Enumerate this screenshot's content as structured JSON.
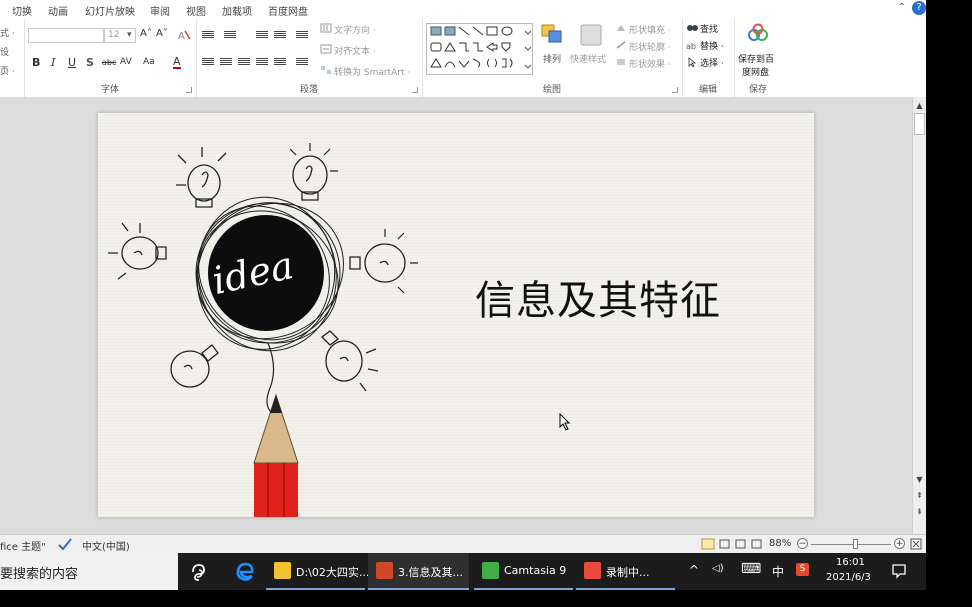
{
  "menu": {
    "tabs": [
      "切换",
      "动画",
      "幻灯片放映",
      "审阅",
      "视图",
      "加载项",
      "百度网盘"
    ],
    "minimize_glyph": "⌃",
    "help_glyph": "?"
  },
  "ribbon": {
    "left_partial": [
      "式 ·",
      "设",
      "页 ·"
    ],
    "font": {
      "label": "字体",
      "size_value": "12",
      "size_arrow": "▾",
      "grow": "A˄",
      "shrink": "A˅",
      "bold": "B",
      "italic": "I",
      "underline": "U",
      "shadow": "S",
      "strike": "abc",
      "spacing": "AV",
      "case": "Aa",
      "color": "A"
    },
    "paragraph": {
      "label": "段落",
      "text_direction": "文字方向 ·",
      "align_text": "对齐文本 ·",
      "smartart": "转换为 SmartArt ·"
    },
    "drawing": {
      "label": "绘图",
      "arrange": "排列",
      "quick_styles": "快速样式",
      "shape_fill": "形状填充 ·",
      "shape_outline": "形状轮廓 ·",
      "shape_effects": "形状效果 ·"
    },
    "editing": {
      "label": "编辑",
      "find": "查找",
      "replace": "替换 ·",
      "select": "选择 ·"
    },
    "save": {
      "label": "保存",
      "line1": "保存到百",
      "line2": "度网盘"
    }
  },
  "slide": {
    "title": "信息及其特征",
    "idea_text": "idea"
  },
  "status": {
    "theme": "fice 主题\"",
    "language": "中文(中国)",
    "zoom": "88%",
    "zoom_minus": "−",
    "zoom_plus": "+",
    "zoom_level": 0.55
  },
  "taskbar": {
    "search_text": "要搜索的内容",
    "apps": [
      {
        "label": "D:\\02大四实...",
        "color": "#f2c230"
      },
      {
        "label": "3.信息及其...",
        "color": "#d24726"
      },
      {
        "label": "Camtasia 9",
        "color": "#3fae49"
      },
      {
        "label": "录制中...",
        "color": "#e84b3c"
      }
    ],
    "tray": {
      "chevron": "^",
      "volume": "◁)",
      "keyboard": "⌨",
      "ime": "中",
      "app": "S"
    },
    "time": "16:01",
    "date": "2021/6/3"
  }
}
